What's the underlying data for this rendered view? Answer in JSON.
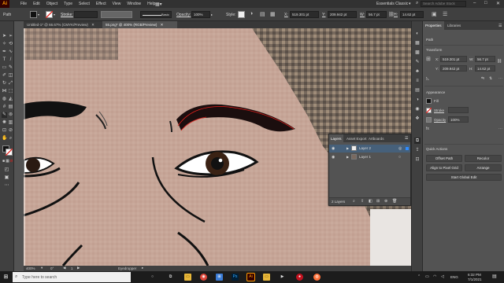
{
  "menubar": {
    "app_logo": "Ai",
    "items": [
      "File",
      "Edit",
      "Object",
      "Type",
      "Select",
      "Effect",
      "View",
      "Window",
      "Help"
    ],
    "workspace": "Essentials Classic",
    "search_placeholder": "Search Adobe Stock",
    "window_controls": [
      "–",
      "□",
      "✕"
    ]
  },
  "controlbar": {
    "selection_type": "Path",
    "stroke_label": "Stroke:",
    "stroke_profile": "Basic",
    "opacity_label": "Opacity:",
    "opacity_value": "100%",
    "style_label": "Style:",
    "x_label": "X:",
    "x_value": "519.301 pt",
    "y_label": "Y:",
    "y_value": "209.942 pt",
    "w_label": "W:",
    "w_value": "56.7 pt",
    "h_label": "H:",
    "h_value": "14.62 pt"
  },
  "tabs": [
    {
      "label": "Untitled-1* @ 66.67% (CMYK/Preview)",
      "close": "✕"
    },
    {
      "label": "55.png* @ 400% (RGB/Preview)",
      "close": "✕"
    }
  ],
  "statusbar": {
    "zoom": "400%",
    "angle": "0°",
    "page": "1",
    "tool": "Eyedropper"
  },
  "properties": {
    "tab_properties": "Properties",
    "tab_libraries": "Libraries",
    "section_path": "Path",
    "section_transform": "Transform",
    "x_label": "X:",
    "x_value": "519.301 pt",
    "y_label": "Y:",
    "y_value": "209.942 pt",
    "w_label": "W:",
    "w_value": "56.7 pt",
    "h_label": "H:",
    "h_value": "14.62 pt",
    "section_appearance": "Appearance",
    "fill_label": "Fill",
    "stroke_label": "Stroke",
    "opacity_label": "Opacity",
    "opacity_value": "100%",
    "section_quick_actions": "Quick Actions",
    "btn_offset_path": "Offset Path",
    "btn_recolor": "Recolor",
    "btn_align_pixel": "Align to Pixel Grid",
    "btn_arrange": "Arrange",
    "btn_start_global_edit": "Start Global Edit"
  },
  "layers": {
    "tab_layers": "Layers",
    "tab_asset_export": "Asset Export",
    "tab_artboards": "Artboards",
    "rows": [
      {
        "name": "Layer 2",
        "selected": true
      },
      {
        "name": "Layer 1",
        "selected": false
      }
    ],
    "count": "2 Layers"
  },
  "taskbar": {
    "search_placeholder": "Type here to search",
    "lang": "ENG",
    "time": "6:32 PM",
    "date": "7/1/2021"
  },
  "colors": {
    "menubar_bg": "#323232",
    "panel_bg": "#535353",
    "accent_ai": "#ff9a00",
    "selection_blue": "#46607a",
    "selection_red": "#e0201b"
  }
}
